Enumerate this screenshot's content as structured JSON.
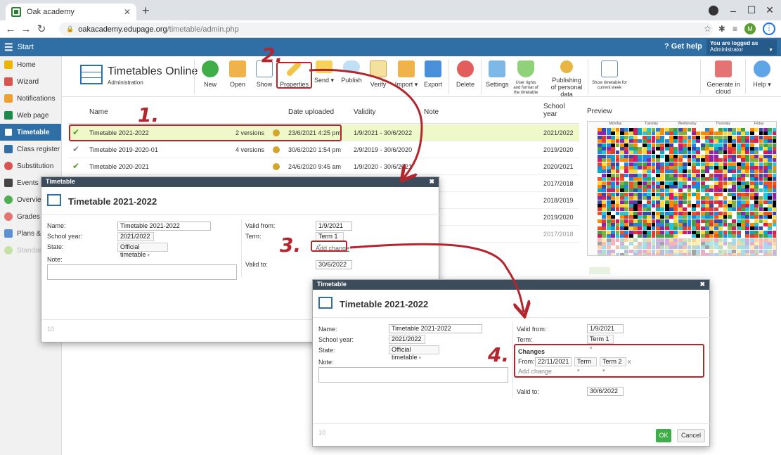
{
  "browser": {
    "tab_title": "Oak academy",
    "url_host": "oakacademy.edupage.org",
    "url_path": "/timetable/admin.php",
    "avatar_letter": "M"
  },
  "header": {
    "start_label": "Start",
    "help_label": "Get help",
    "logged_line1": "You are logged as",
    "logged_line2": "Administrator"
  },
  "sidebar": {
    "items": [
      {
        "label": "Home",
        "color": "#f0b400"
      },
      {
        "label": "Wizard",
        "color": "#d9534f"
      },
      {
        "label": "Notifications",
        "color": "#f0a030"
      },
      {
        "label": "Web page",
        "color": "#1b8a4a"
      },
      {
        "label": "Timetable",
        "color": "#ffffff"
      },
      {
        "label": "Class register",
        "color": "#2f6fa6"
      },
      {
        "label": "Substitution",
        "color": "#d9534f"
      },
      {
        "label": "Events",
        "color": "#444444"
      },
      {
        "label": "Overview",
        "color": "#4caf50"
      },
      {
        "label": "Grades",
        "color": "#e57373"
      },
      {
        "label": "Plans & P",
        "color": "#5c8fd6"
      },
      {
        "label": "Standards",
        "color": "#9ccc65"
      }
    ]
  },
  "toolbar": {
    "title": "Timetables Online",
    "subtitle": "Administration",
    "buttons": {
      "new": "New",
      "open": "Open",
      "show": "Show",
      "properties": "Properties",
      "send": "Send",
      "publish": "Publish",
      "verify": "Verify",
      "import": "Import",
      "export": "Export",
      "delete": "Delete",
      "settings": "Settings",
      "user_rights": "User rights and format of the timetable",
      "publishing": "Publishing of personal data",
      "show_timetable": "Show timetable for current week",
      "generate": "Generate in cloud",
      "help": "Help"
    }
  },
  "grid": {
    "headers": {
      "name": "Name",
      "date_uploaded": "Date uploaded",
      "validity": "Validity",
      "note": "Note",
      "school_year_1": "School",
      "school_year_2": "year"
    },
    "rows": [
      {
        "name": "Timetable 2021-2022",
        "versions": "2 versions",
        "date": "23/6/2021 4:25 pm",
        "validity": "1/9/2021 - 30/6/2022",
        "year": "2021/2022"
      },
      {
        "name": "Timetable 2019-2020-01",
        "versions": "4 versions",
        "date": "30/6/2020 1:54 pm",
        "validity": "2/9/2019 - 30/6/2020",
        "year": "2019/2020"
      },
      {
        "name": "Timetable 2020-2021",
        "versions": "",
        "date": "24/6/2020 9:45 am",
        "validity": "1/9/2020 - 30/6/2021",
        "year": "2020/2021"
      }
    ],
    "extra_years": [
      "2017/2018",
      "2018/2019",
      "2019/2020",
      "2017/2018"
    ]
  },
  "preview": {
    "title": "Preview",
    "days": [
      "Monday",
      "Tuesday",
      "Wednesday",
      "Thursday",
      "Friday"
    ]
  },
  "dialog1": {
    "bar_title": "Timetable",
    "title": "Timetable 2021-2022",
    "name_label": "Name:",
    "name_value": "Timetable 2021-2022",
    "school_year_label": "School year:",
    "school_year_value": "2021/2022",
    "state_label": "State:",
    "state_value": "Official timetable",
    "note_label": "Note:",
    "valid_from_label": "Valid from:",
    "valid_from_value": "1/9/2021",
    "term_label": "Term:",
    "term_value": "Term 1",
    "add_change": "Add change",
    "valid_to_label": "Valid to:",
    "valid_to_value": "30/6/2022",
    "footer_id": "10"
  },
  "dialog2": {
    "bar_title": "Timetable",
    "title": "Timetable 2021-2022",
    "name_label": "Name:",
    "name_value": "Timetable 2021-2022",
    "school_year_label": "School year:",
    "school_year_value": "2021/2022",
    "state_label": "State:",
    "state_value": "Official timetable",
    "note_label": "Note:",
    "valid_from_label": "Valid from:",
    "valid_from_value": "1/9/2021",
    "term_label": "Term:",
    "term_value": "Term 1",
    "changes_label": "Changes",
    "from_label": "From:",
    "from_value": "22/11/2021",
    "term_select": "Term",
    "term2_select": "Term 2",
    "remove": "x",
    "add_change": "Add change",
    "valid_to_label": "Valid to:",
    "valid_to_value": "30/6/2022",
    "footer_id": "10",
    "ok": "OK",
    "cancel": "Cancel"
  },
  "annotations": {
    "step1": "1.",
    "step2": "2.",
    "step3": "3.",
    "step4": "4.",
    "color": "#b3262e"
  }
}
